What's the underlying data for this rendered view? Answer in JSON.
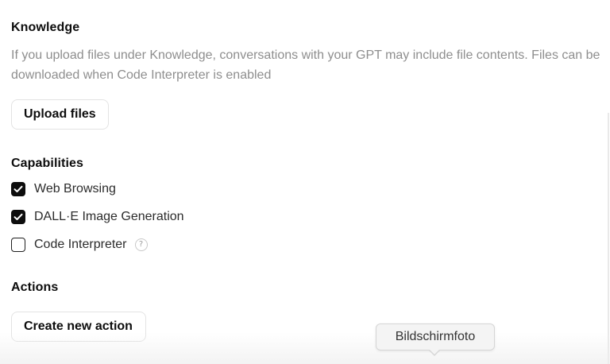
{
  "knowledge": {
    "title": "Knowledge",
    "description": "If you upload files under Knowledge, conversations with your GPT may include file contents. Files can be downloaded when Code Interpreter is enabled",
    "upload_button_label": "Upload files"
  },
  "capabilities": {
    "title": "Capabilities",
    "items": [
      {
        "label": "Web Browsing",
        "checked": true
      },
      {
        "label": "DALL·E Image Generation",
        "checked": true
      },
      {
        "label": "Code Interpreter",
        "checked": false,
        "help_icon": "question-mark-circle-icon",
        "help_glyph": "?"
      }
    ]
  },
  "actions": {
    "title": "Actions",
    "create_button_label": "Create new action"
  },
  "tooltip": {
    "text": "Bildschirmfoto"
  },
  "colors": {
    "checkbox_checked": "#0d0d0d",
    "description_text": "#8e8e8e",
    "button_border": "#e3e3e3"
  }
}
